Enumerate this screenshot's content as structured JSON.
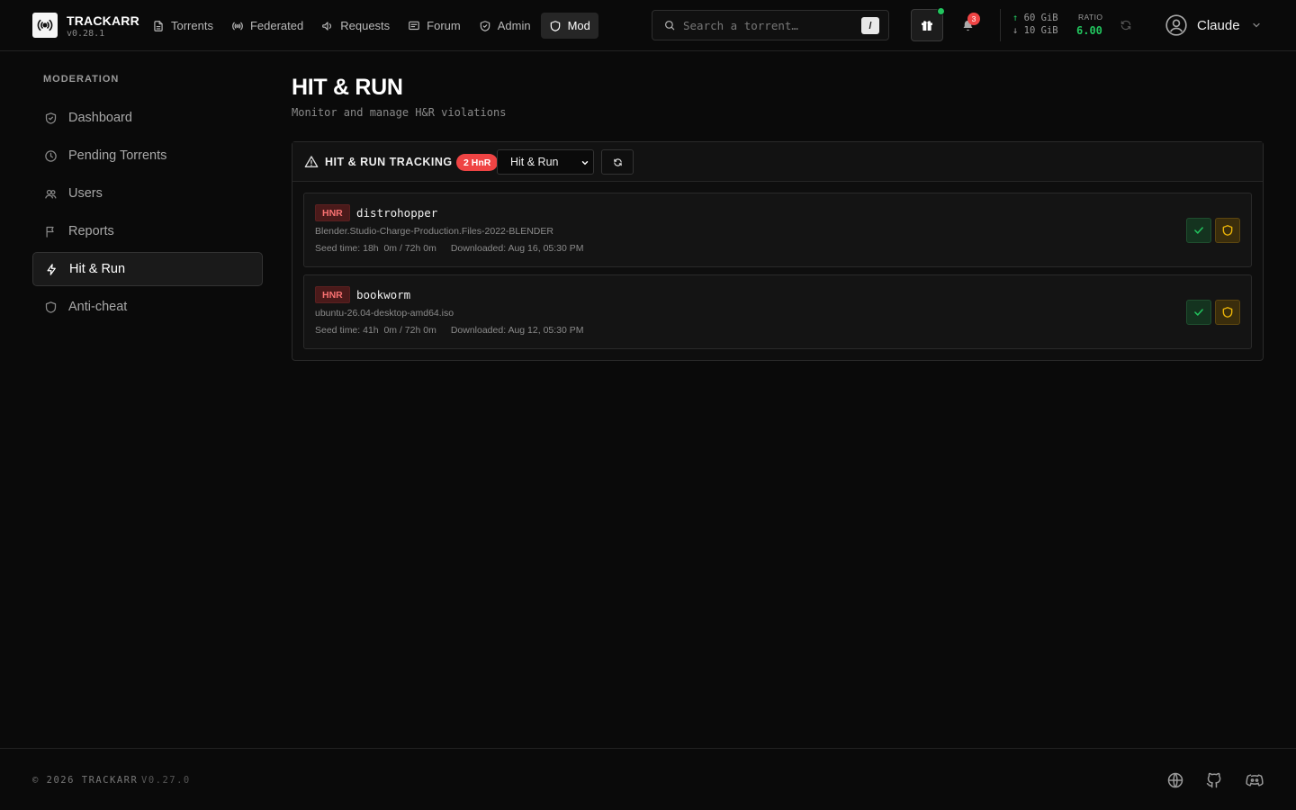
{
  "brand": {
    "name": "TRACKARR",
    "version": "v0.28.1"
  },
  "nav": [
    {
      "label": "Torrents",
      "icon": "file-icon"
    },
    {
      "label": "Federated",
      "icon": "broadcast-icon"
    },
    {
      "label": "Requests",
      "icon": "megaphone-icon"
    },
    {
      "label": "Forum",
      "icon": "message-icon"
    },
    {
      "label": "Admin",
      "icon": "shield-check-icon"
    },
    {
      "label": "Mod",
      "icon": "shield-icon",
      "active": true
    }
  ],
  "search": {
    "placeholder": "Search a torrent…",
    "shortcut": "/"
  },
  "notifications": {
    "count": "3"
  },
  "stats": {
    "upload": "60 GiB",
    "download": "10 GiB",
    "ratio_label": "RATIO",
    "ratio": "6.00"
  },
  "user": {
    "name": "Claude"
  },
  "sidebar": {
    "title": "MODERATION",
    "items": [
      {
        "label": "Dashboard",
        "icon": "shield-check-icon"
      },
      {
        "label": "Pending Torrents",
        "icon": "clock-icon"
      },
      {
        "label": "Users",
        "icon": "users-icon"
      },
      {
        "label": "Reports",
        "icon": "flag-icon"
      },
      {
        "label": "Hit & Run",
        "icon": "bolt-icon",
        "active": true
      },
      {
        "label": "Anti-cheat",
        "icon": "shield-icon"
      }
    ]
  },
  "page": {
    "title": "HIT & RUN",
    "subtitle": "Monitor and manage H&R violations"
  },
  "panel": {
    "title": "HIT & RUN TRACKING",
    "badge": "2 HnR",
    "filter_selected": "Hit & Run",
    "rows": [
      {
        "tag": "HNR",
        "user": "distrohopper",
        "file": "Blender.Studio-Charge-Production.Files-2022-BLENDER",
        "seed": "Seed time: 18h  0m / 72h 0m",
        "downloaded": "Downloaded: Aug 16, 05:30 PM"
      },
      {
        "tag": "HNR",
        "user": "bookworm",
        "file": "ubuntu-26.04-desktop-amd64.iso",
        "seed": "Seed time: 41h  0m / 72h 0m",
        "downloaded": "Downloaded: Aug 12, 05:30 PM"
      }
    ]
  },
  "footer": {
    "copyright": "© 2026 TRACKARR",
    "version": "V0.27.0"
  },
  "colors": {
    "accent_green": "#22c55e",
    "danger_red": "#ef4444",
    "warn_yellow": "#eab308"
  }
}
